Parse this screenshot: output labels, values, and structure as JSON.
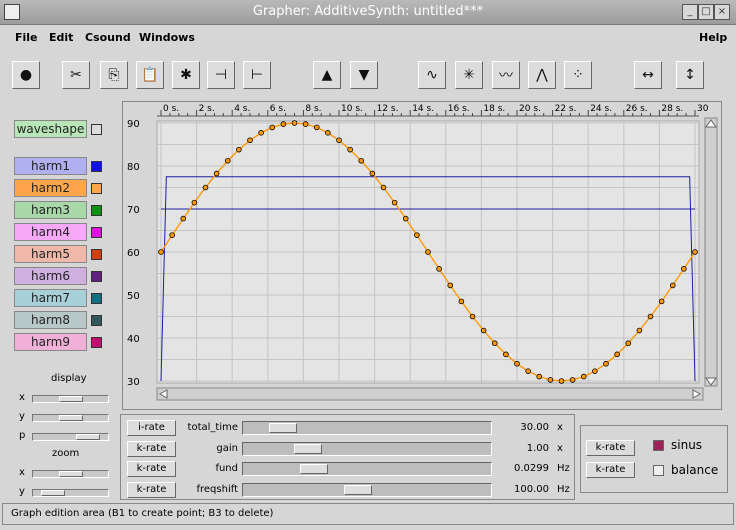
{
  "window": {
    "title": "Grapher: AdditiveSynth: untitled***",
    "buttons": [
      "_",
      "□",
      "×"
    ]
  },
  "menu": {
    "items": [
      "File",
      "Edit",
      "Csound",
      "Windows"
    ],
    "help": "Help"
  },
  "toolbar": {
    "icons": [
      "record-icon",
      "cut-icon",
      "copy-icon",
      "paste-icon",
      "settings-icon",
      "export-wave-icon",
      "import-wave-icon",
      "move-up-icon",
      "move-down-icon",
      "sine-wave-icon",
      "scatter-icon",
      "noise-icon",
      "random-wave-icon",
      "dotted-wave-icon",
      "stretch-horizontal-icon",
      "stretch-vertical-icon"
    ],
    "glyphs": [
      "●",
      "✂",
      "⎘",
      "📋",
      "✱",
      "⊣",
      "⊢",
      "▲",
      "▼",
      "∿",
      "✳",
      "〰",
      "⋀",
      "⁘",
      "↔",
      "↕"
    ]
  },
  "left": {
    "waveshape": {
      "label": "waveshape",
      "color": "#b8e6b8"
    },
    "harmonics": [
      {
        "label": "harm1",
        "bg": "#b0b0f0",
        "swatch": "#1010e0"
      },
      {
        "label": "harm2",
        "bg": "#ffa64d",
        "swatch": "#ffa64d"
      },
      {
        "label": "harm3",
        "bg": "#a8d8a8",
        "swatch": "#109010"
      },
      {
        "label": "harm4",
        "bg": "#f8a8f8",
        "swatch": "#e010e0"
      },
      {
        "label": "harm5",
        "bg": "#f0b8a8",
        "swatch": "#d04010"
      },
      {
        "label": "harm6",
        "bg": "#d0b0e0",
        "swatch": "#602080"
      },
      {
        "label": "harm7",
        "bg": "#a8d0d8",
        "swatch": "#107080"
      },
      {
        "label": "harm8",
        "bg": "#b8c8c8",
        "swatch": "#305858"
      },
      {
        "label": "harm9",
        "bg": "#f0b0d8",
        "swatch": "#c01070"
      }
    ],
    "display_label": "display",
    "zoom_label": "zoom",
    "display_axes": [
      "x",
      "y",
      "p"
    ],
    "zoom_axes": [
      "x",
      "y"
    ],
    "slider_levels": [
      0.5,
      0.5,
      0.85,
      0.5,
      0.15
    ]
  },
  "graph": {
    "x_ticks": [
      "0 s.",
      "2 s.",
      "4 s.",
      "6 s.",
      "8 s.",
      "10 s.",
      "12 s.",
      "14 s.",
      "16 s.",
      "18 s.",
      "20 s.",
      "22 s.",
      "24 s.",
      "26 s.",
      "28 s.",
      "30"
    ],
    "y_ticks": [
      "90",
      "80",
      "70",
      "60",
      "50",
      "40",
      "30"
    ]
  },
  "chart_data": {
    "type": "line",
    "xlim": [
      0,
      30
    ],
    "ylim": [
      30,
      90
    ],
    "grid": true,
    "series": [
      {
        "color": "#ff9900",
        "marker": "circle",
        "shape": "sine",
        "points": 49,
        "x_start": 0,
        "x_end": 30,
        "center": 60,
        "amplitude": 30,
        "periods": 1
      },
      {
        "color": "#1f1fa0",
        "shape": "hline",
        "y": 70
      },
      {
        "color": "#1f1fa0",
        "shape": "envelope",
        "points": [
          [
            0,
            30
          ],
          [
            0.3,
            77.5
          ],
          [
            29.7,
            77.5
          ],
          [
            30,
            30
          ]
        ]
      }
    ]
  },
  "params": [
    {
      "rate": "i-rate",
      "name": "total_time",
      "value": "30.00",
      "unit": "x",
      "level": 0.12
    },
    {
      "rate": "k-rate",
      "name": "gain",
      "value": "1.00",
      "unit": "x",
      "level": 0.23
    },
    {
      "rate": "k-rate",
      "name": "fund",
      "value": "0.0299",
      "unit": "Hz",
      "level": 0.26
    },
    {
      "rate": "k-rate",
      "name": "freqshift",
      "value": "100.00",
      "unit": "Hz",
      "level": 0.46
    }
  ],
  "right": {
    "rates": [
      "k-rate",
      "k-rate"
    ],
    "options": [
      {
        "label": "sinus",
        "checked": true
      },
      {
        "label": "balance",
        "checked": false
      }
    ]
  },
  "status": {
    "text": "Graph edition area (B1 to create point; B3 to delete)"
  },
  "colors": {
    "checked": "#a0205a",
    "bg": "#d6d6d6"
  }
}
